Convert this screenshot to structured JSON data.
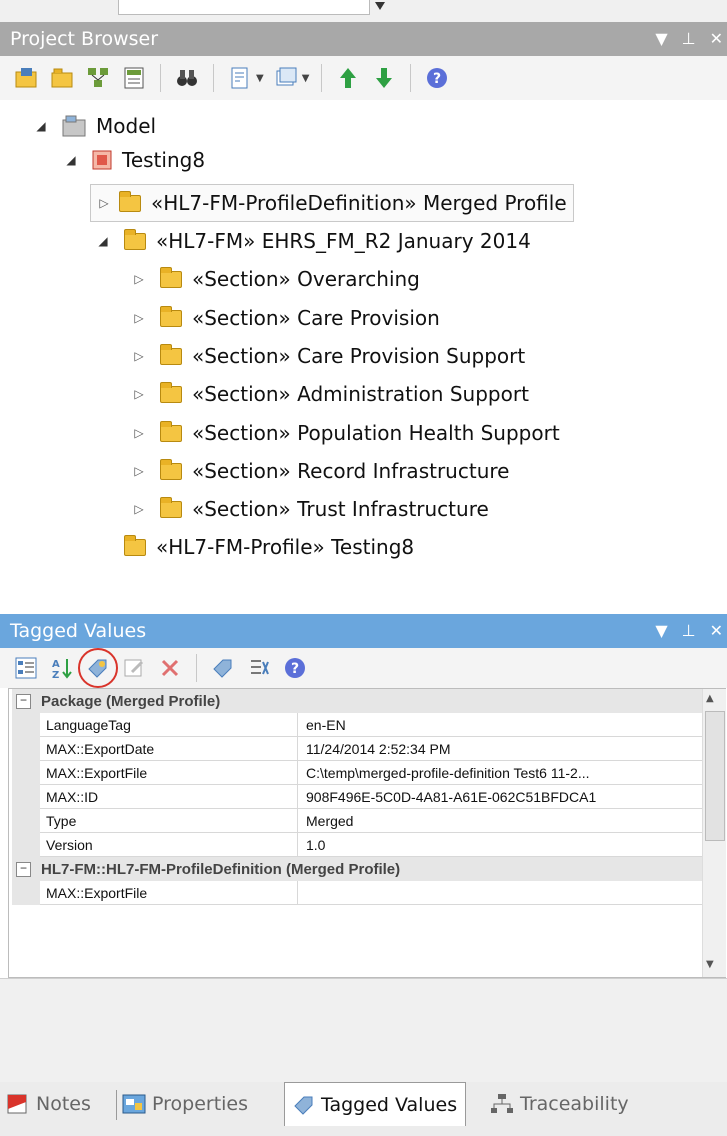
{
  "project_browser": {
    "title": "Project Browser",
    "tree": {
      "model": "Model",
      "testing8": "Testing8",
      "merged_profile": "«HL7-FM-ProfileDefinition» Merged Profile",
      "ehrs": "«HL7-FM» EHRS_FM_R2 January 2014",
      "sections": [
        "«Section» Overarching",
        "«Section» Care Provision",
        "«Section» Care Provision Support",
        "«Section» Administration Support",
        "«Section» Population Health Support",
        "«Section» Record Infrastructure",
        "«Section» Trust Infrastructure"
      ],
      "profile_testing8": "«HL7-FM-Profile» Testing8"
    }
  },
  "tagged_values": {
    "title": "Tagged Values",
    "groups": [
      {
        "name": "Package (Merged Profile)",
        "rows": [
          {
            "key": "LanguageTag",
            "value": "en-EN"
          },
          {
            "key": "MAX::ExportDate",
            "value": "11/24/2014 2:52:34 PM"
          },
          {
            "key": "MAX::ExportFile",
            "value": "C:\\temp\\merged-profile-definition Test6 11-2..."
          },
          {
            "key": "MAX::ID",
            "value": "908F496E-5C0D-4A81-A61E-062C51BFDCA1"
          },
          {
            "key": "Type",
            "value": "Merged"
          },
          {
            "key": "Version",
            "value": "1.0"
          }
        ]
      },
      {
        "name": "HL7-FM::HL7-FM-ProfileDefinition (Merged Profile)",
        "rows": [
          {
            "key": "MAX::ExportFile",
            "value": ""
          }
        ]
      }
    ]
  },
  "tabs": {
    "notes": "Notes",
    "properties": "Properties",
    "tagged_values": "Tagged Values",
    "traceability": "Traceability"
  },
  "colors": {
    "active_title": "#6aa6dd",
    "inactive_title": "#a8a8a8",
    "folder": "#f4c542",
    "highlight_circle": "#d9342b"
  }
}
